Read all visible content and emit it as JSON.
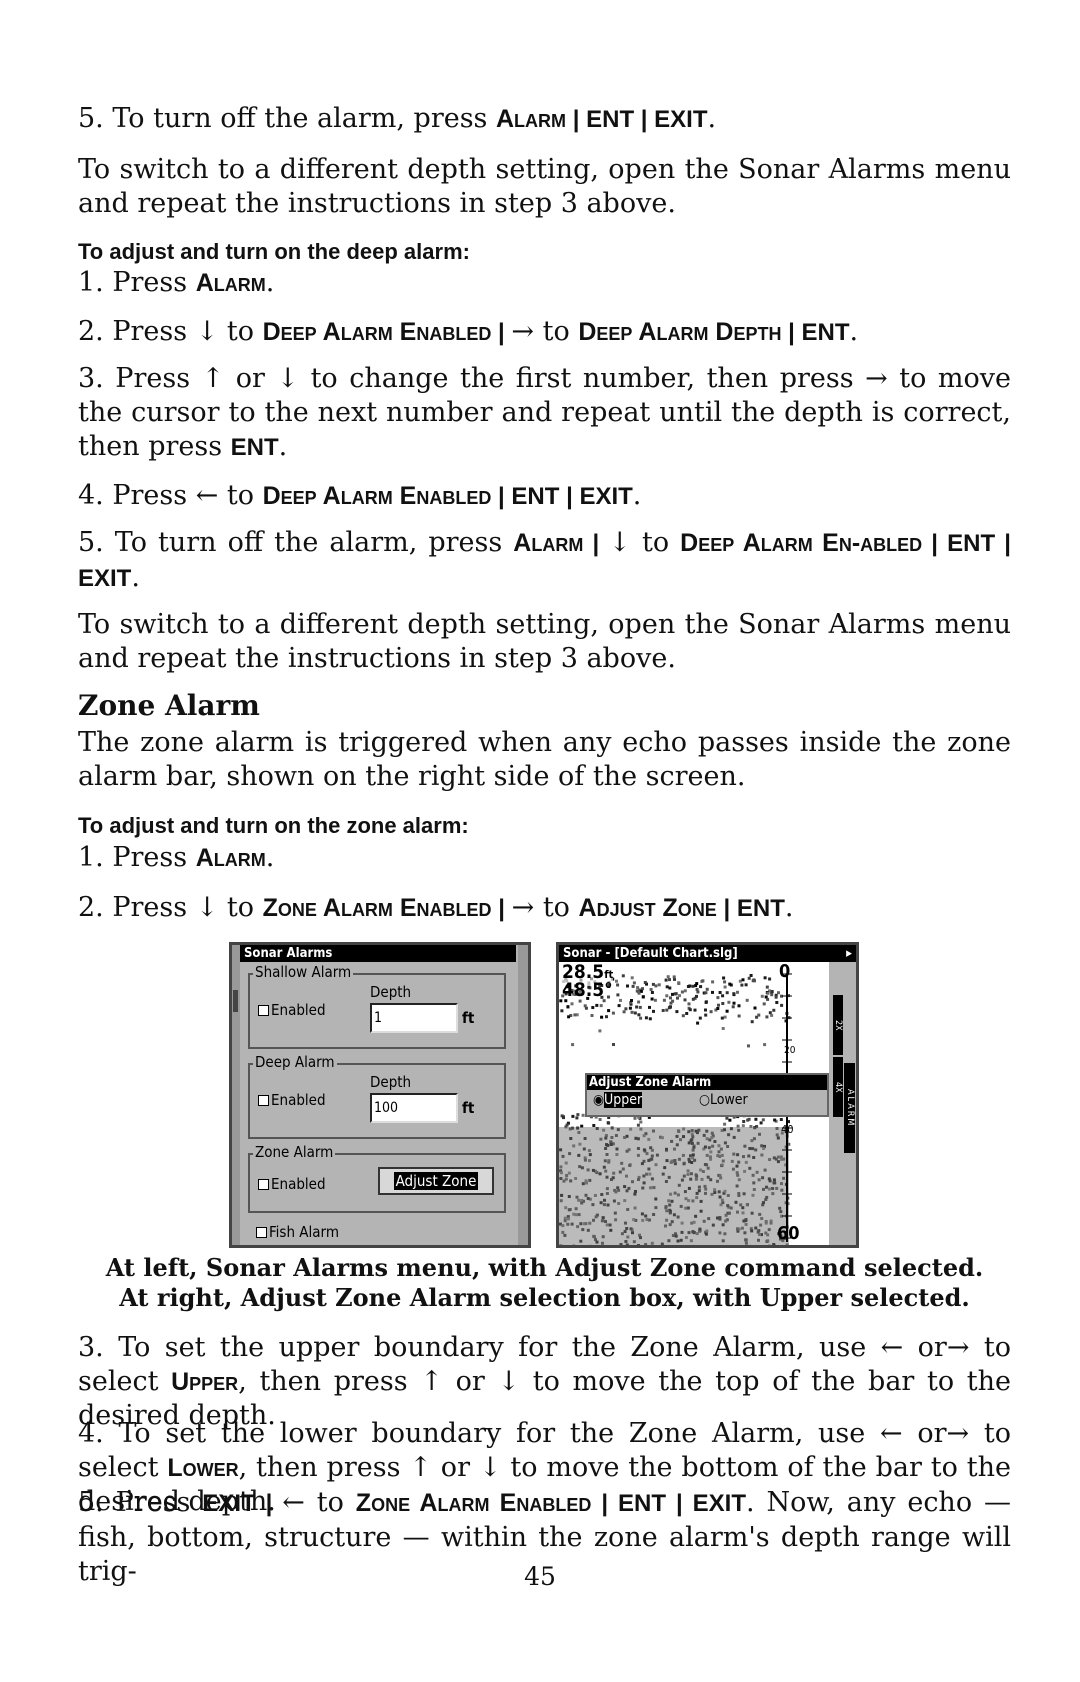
{
  "paragraphs": [
    {
      "segs": [
        [
          "r",
          "5. To turn off the alarm, press "
        ],
        [
          "sc",
          "Alarm"
        ],
        [
          "b",
          " | ENT | EXIT"
        ],
        [
          "r",
          "."
        ]
      ]
    },
    {
      "segs": [
        [
          "r",
          "To switch to a different depth setting, open the Sonar Alarms menu and repeat the instructions in step 3 above."
        ]
      ]
    },
    {
      "segs": [
        [
          "h",
          "To adjust and turn on the deep alarm:"
        ]
      ]
    },
    {
      "segs": [
        [
          "r",
          "1. Press "
        ],
        [
          "sc",
          "Alarm"
        ],
        [
          "r",
          "."
        ]
      ]
    },
    {
      "segs": [
        [
          "r",
          "2. Press ↓ to "
        ],
        [
          "sc",
          "Deep Alarm Enabled"
        ],
        [
          "b",
          " | "
        ],
        [
          "r",
          "→ to "
        ],
        [
          "sc",
          "Deep Alarm Depth"
        ],
        [
          "b",
          " | ENT"
        ],
        [
          "r",
          "."
        ]
      ]
    },
    {
      "segs": [
        [
          "r",
          "3. Press ↑ or ↓ to change the first number, then press → to move the cursor to the next number and repeat until the depth is correct, then press "
        ],
        [
          "b",
          "ENT"
        ],
        [
          "r",
          "."
        ]
      ]
    },
    {
      "segs": [
        [
          "r",
          "4. Press ← to "
        ],
        [
          "sc",
          "Deep Alarm Enabled"
        ],
        [
          "b",
          " | ENT | EXIT"
        ],
        [
          "r",
          "."
        ]
      ]
    },
    {
      "segs": [
        [
          "r",
          "5. To turn off the alarm, press "
        ],
        [
          "sc",
          "Alarm"
        ],
        [
          "b",
          " | "
        ],
        [
          "r",
          "↓ to "
        ],
        [
          "sc",
          "Deep Alarm En-abled"
        ],
        [
          "b",
          " | ENT | EXIT"
        ],
        [
          "r",
          "."
        ]
      ]
    },
    {
      "segs": [
        [
          "r",
          "To switch to a different depth setting, open the Sonar Alarms menu and repeat the instructions in step 3 above."
        ]
      ]
    },
    {
      "segs": [
        [
          "h2",
          "Zone Alarm"
        ]
      ]
    },
    {
      "segs": [
        [
          "r",
          "The zone alarm is triggered when any echo passes inside the zone alarm bar, shown on the right side of the screen."
        ]
      ]
    },
    {
      "segs": [
        [
          "h",
          "To adjust and turn on the zone alarm:"
        ]
      ]
    },
    {
      "segs": [
        [
          "r",
          "1. Press "
        ],
        [
          "sc",
          "Alarm"
        ],
        [
          "r",
          "."
        ]
      ]
    },
    {
      "segs": [
        [
          "r",
          "2. Press ↓ to "
        ],
        [
          "sc",
          "Zone Alarm Enabled"
        ],
        [
          "b",
          " | "
        ],
        [
          "r",
          "→ to "
        ],
        [
          "sc",
          "Adjust Zone"
        ],
        [
          "b",
          " | ENT"
        ],
        [
          "r",
          "."
        ]
      ]
    },
    {
      "segs": [
        [
          "r",
          "3. To set the upper boundary for the Zone Alarm, use ← or→ to select "
        ],
        [
          "sc",
          "Upper"
        ],
        [
          "r",
          ", then press ↑ or ↓ to move the top of the bar to the desired depth."
        ]
      ]
    },
    {
      "segs": [
        [
          "r",
          "4. To set the lower boundary for the Zone Alarm, use ← or→ to select "
        ],
        [
          "sc",
          "Lower"
        ],
        [
          "r",
          ", then press ↑ or ↓ to move the bottom of the bar to the desired depth."
        ]
      ]
    },
    {
      "segs": [
        [
          "r",
          "5. Press "
        ],
        [
          "b",
          "EXIT | "
        ],
        [
          "r",
          "← to "
        ],
        [
          "sc",
          "Zone Alarm Enabled"
        ],
        [
          "b",
          " | ENT | EXIT"
        ],
        [
          "r",
          ". Now, any echo — fish, bottom, structure — within the zone alarm's depth range will trig-"
        ]
      ]
    }
  ],
  "caption": {
    "line1": "At left, Sonar Alarms menu, with Adjust Zone command selected.",
    "line2": "At right, Adjust Zone Alarm selection box, with Upper  selected."
  },
  "page_number": "45",
  "alarms_menu": {
    "title": "Sonar Alarms",
    "shallow": {
      "legend": "Shallow Alarm",
      "enabled": "Enabled",
      "depth_label": "Depth",
      "depth": "1",
      "unit": "ft",
      "checked": false
    },
    "deep": {
      "legend": "Deep Alarm",
      "enabled": "Enabled",
      "depth_label": "Depth",
      "depth": "100",
      "unit": "ft",
      "checked": false
    },
    "zone": {
      "legend": "Zone Alarm",
      "enabled": "Enabled",
      "button": "Adjust Zone",
      "checked": false
    },
    "fish": {
      "label": "Fish Alarm",
      "checked": false
    }
  },
  "sonar_screen": {
    "title": "Sonar - [Default Chart.slg]",
    "depth_readout": "28.5",
    "depth_unit": "ft",
    "temp_readout": "48.5°",
    "scale": [
      "0",
      "20",
      "40",
      "60"
    ],
    "zoom_labels": [
      "2X",
      "4X"
    ],
    "alarm_label": "ALARM",
    "dialog": {
      "title": "Adjust Zone Alarm",
      "options": [
        "Upper",
        "Lower"
      ],
      "selected": "Upper"
    }
  }
}
